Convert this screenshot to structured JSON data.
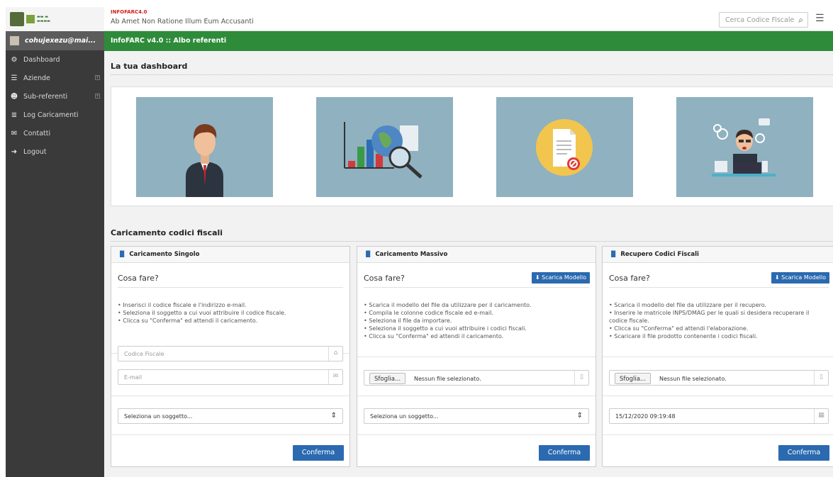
{
  "sidebar": {
    "user": "cohujexezu@mai...",
    "items": [
      {
        "label": "Dashboard",
        "icon": "gears-icon"
      },
      {
        "label": "Aziende",
        "icon": "list-icon",
        "expandable": true
      },
      {
        "label": "Sub-referenti",
        "icon": "users-icon",
        "expandable": true
      },
      {
        "label": "Log Caricamenti",
        "icon": "database-icon"
      },
      {
        "label": "Contatti",
        "icon": "envelope-icon"
      },
      {
        "label": "Logout",
        "icon": "logout-icon"
      }
    ]
  },
  "header": {
    "app_code": "INFOFARC4.0",
    "subtitle": "Ab Amet Non Ratione Illum Eum Accusanti",
    "search_placeholder": "Cerca Codice Fiscale"
  },
  "breadcrumb": "InfoFARC v4.0 :: Albo referenti",
  "dashboard_title": "La tua dashboard",
  "upload_title": "Caricamento codici fiscali",
  "cards": [
    {
      "title": "Caricamento Singolo",
      "what_label": "Cosa fare?",
      "bullets": [
        "Inserisci il codice fiscale e l'indirizzo e-mail.",
        "Seleziona il soggetto a cui vuoi attribuire il codice fiscale.",
        "Clicca su \"Conferma\" ed attendi il caricamento."
      ],
      "codice_placeholder": "Codice Fiscale",
      "email_placeholder": "E-mail",
      "select_value": "Seleziona un soggetto...",
      "confirm": "Conferma"
    },
    {
      "title": "Caricamento Massivo",
      "what_label": "Cosa fare?",
      "download_label": "Scarica Modello",
      "bullets": [
        "Scarica il modello del file da utilizzare per il caricamento.",
        "Compila le colonne codice fiscale ed e-mail.",
        "Seleziona il file da importare.",
        "Seleziona il soggetto a cui vuoi attribuire i codici fiscali.",
        "Clicca su \"Conferma\" ed attendi il caricamento."
      ],
      "browse_label": "Sfoglia...",
      "file_status": "Nessun file selezionato.",
      "select_value": "Seleziona un soggetto...",
      "confirm": "Conferma"
    },
    {
      "title": "Recupero Codici Fiscali",
      "what_label": "Cosa fare?",
      "download_label": "Scarica Modello",
      "bullets": [
        "Scarica il modello del file da utilizzare per il recupero.",
        "Inserire le matricole INPS/DMAG per le quali si desidera recuperare il codice fiscale.",
        "Clicca su \"Conferma\" ed attendi l'elaborazione.",
        "Scaricare il file prodotto contenente i codici fiscali."
      ],
      "browse_label": "Sfoglia...",
      "file_status": "Nessun file selezionato.",
      "date_value": "15/12/2020 09:19:48",
      "confirm": "Conferma"
    }
  ],
  "colors": {
    "sidebar": "#3a3a3a",
    "green_bar": "#2e8b3a",
    "primary": "#2b6ab0",
    "tile": "#8fb1c0",
    "app_code": "#d0201c"
  }
}
